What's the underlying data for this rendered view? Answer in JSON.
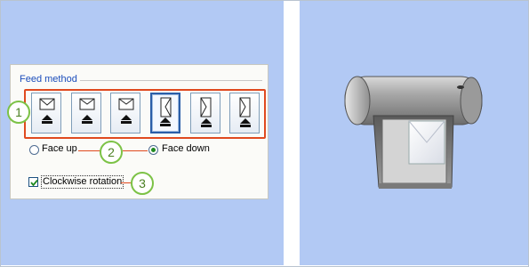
{
  "feed_method": {
    "title": "Feed method",
    "buttons": [
      {
        "icon": "envelope-flap-left-icon",
        "selected": false
      },
      {
        "icon": "envelope-flap-up-icon",
        "selected": false
      },
      {
        "icon": "envelope-flap-up-icon",
        "selected": false
      },
      {
        "icon": "envelope-rotated-icon",
        "selected": true
      },
      {
        "icon": "envelope-rotated-icon",
        "selected": false
      },
      {
        "icon": "envelope-rotated-icon",
        "selected": false
      }
    ]
  },
  "options": {
    "face_up": {
      "label": "Face up",
      "checked": false
    },
    "face_down": {
      "label": "Face down",
      "checked": true
    },
    "clockwise": {
      "label": "Clockwise rotation",
      "checked": true
    }
  },
  "callouts": [
    "1",
    "2",
    "3"
  ],
  "colors": {
    "background": "#b2c9f4",
    "highlight": "#e04a1f",
    "callout_ring": "#7cc246",
    "label_blue": "#1b4dbb"
  },
  "illustration": {
    "icon": "printer-with-envelope-icon"
  }
}
